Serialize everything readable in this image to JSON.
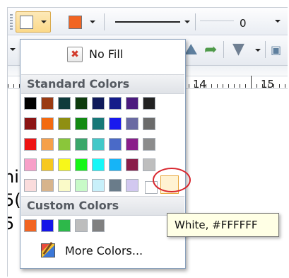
{
  "toolbar": {
    "fill_color": "#ffffff",
    "line_color": "#f26522",
    "line_width_value": "0"
  },
  "ruler": {
    "labels": [
      "14",
      "15"
    ]
  },
  "document": {
    "fragments": [
      "hi",
      "5(",
      "5"
    ]
  },
  "color_menu": {
    "no_fill_label": "No Fill",
    "standard_header": "Standard Colors",
    "standard_colors": [
      [
        "#000000",
        "#9a3a12",
        "#0f3b3b",
        "#0e3b0e",
        "#0f1a5a",
        "#141c8a",
        "#4b1b7e",
        "#222222"
      ],
      [
        "#8b1414",
        "#f36a10",
        "#8f8f12",
        "#138a13",
        "#177878",
        "#1919ee",
        "#6a6aa2",
        "#6b6b6b"
      ],
      [
        "#ee1414",
        "#f5a04a",
        "#8ac63a",
        "#3aa76a",
        "#42c8c8",
        "#4a6ac8",
        "#8a1e8a",
        "#8c8c8c"
      ],
      [
        "#f7a0c8",
        "#f7c81e",
        "#f7f71a",
        "#16f716",
        "#16f7f7",
        "#16b4f7",
        "#8a1e4a",
        "#bebebe"
      ],
      [
        "#fadcdc",
        "#d7b48c",
        "#fafac8",
        "#c8fac8",
        "#c8f0fa",
        "#6a7c8a",
        "#d2c8f0",
        "#ffffff"
      ]
    ],
    "custom_header": "Custom Colors",
    "custom_colors": [
      "#f26522",
      "#1515e8",
      "#2db84a",
      "#bdbdbd",
      "#808080"
    ],
    "more_colors_label": "More Colors...",
    "hovered_color": "#ffffff"
  },
  "tooltip": {
    "text": "White, #FFFFFF"
  }
}
